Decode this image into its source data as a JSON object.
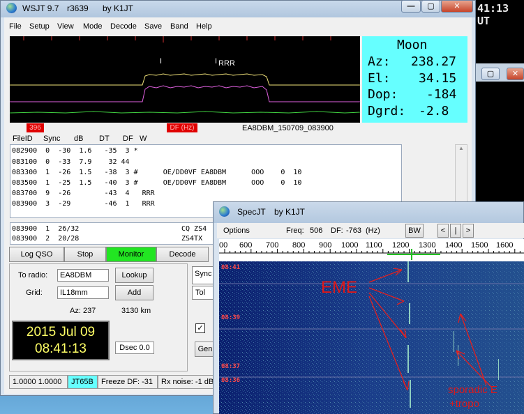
{
  "background_window": {
    "time": "41:13 UT"
  },
  "main_window": {
    "title": "WSJT 9.7",
    "revision": "r3639",
    "author": "by K1JT",
    "menu": [
      "File",
      "Setup",
      "View",
      "Mode",
      "Decode",
      "Save",
      "Band",
      "Help"
    ],
    "moon": {
      "label": "Moon",
      "az_label": "Az:",
      "az": "238.27",
      "el_label": "El:",
      "el": "34.15",
      "dop_label": "Dop:",
      "dop": "-184",
      "dgrd_label": "Dgrd:",
      "dgrd": "-2.8"
    },
    "waterfall_labels": {
      "mark1": "I",
      "mark2": "I",
      "rrr": "RRR"
    },
    "tag_left": "396",
    "tag_df": "DF (Hz)",
    "filename": "EA8DBM_150709_083900",
    "decode_header": [
      "FileID",
      "Sync",
      "dB",
      "DT",
      "DF",
      "W"
    ],
    "decode_lines": [
      "082900  0  -30  1.6   -35  3 *",
      "083100  0  -33  7.9    32 44",
      "083300  1  -26  1.5   -38  3 #      OE/DD0VF EA8DBM      OOO    0  10",
      "083500  1  -25  1.5   -40  3 #      OE/DD0VF EA8DBM      OOO    0  10",
      "083700  9  -26        -43  4   RRR",
      "083900  3  -29        -46  1   RRR"
    ],
    "avg_lines": [
      "083900  1  26/32",
      "083900  2  20/28"
    ],
    "avg_right": [
      "CQ ZS4",
      "ZS4TX"
    ],
    "buttons": {
      "log_qso": "Log QSO",
      "stop": "Stop",
      "monitor": "Monitor",
      "decode": "Decode"
    },
    "to_radio_label": "To radio:",
    "to_radio": "EA8DBM",
    "lookup": "Lookup",
    "grid_label": "Grid:",
    "grid": "IL18mm",
    "add": "Add",
    "az": "Az: 237",
    "distance": "3130 km",
    "date": "2015 Jul 09",
    "time": "08:41:13",
    "dsec": "Dsec  0.0",
    "sync_label": "Sync",
    "tol_label": "Tol",
    "gen_label": "Gen",
    "status": {
      "ratio": "1.0000 1.0000",
      "mode": "JT65B",
      "freeze": "Freeze DF: -31",
      "rx": "Rx noise: -1 dB"
    }
  },
  "specjt": {
    "title": "SpecJT",
    "author": "by K1JT",
    "options": "Options",
    "freq_label": "Freq:",
    "freq": "506",
    "df_label": "DF:",
    "df": "-763",
    "df_unit": "(Hz)",
    "bw": "BW",
    "nav": [
      "<",
      "|",
      ">"
    ],
    "scale": [
      "00",
      "600",
      "700",
      "800",
      "900",
      "1000",
      "1100",
      "1200",
      "1300",
      "1400",
      "1500",
      "1600"
    ],
    "timestamps": [
      "08:41",
      "08:39",
      "08:37",
      "08:36"
    ],
    "annotations": {
      "eme": "EME",
      "sporadic": "sporadic E",
      "tropo": "+tropo"
    }
  }
}
